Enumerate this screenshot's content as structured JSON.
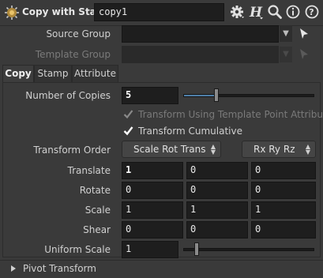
{
  "header": {
    "title": "Copy with Stamp",
    "node_name": "copy1",
    "icons": [
      "gear-icon",
      "help-h-icon",
      "search-icon",
      "info-icon",
      "question-icon"
    ]
  },
  "source_group": {
    "label": "Source Group",
    "value": ""
  },
  "template_group": {
    "label": "Template Group",
    "value": ""
  },
  "tabs": [
    {
      "label": "Copy",
      "active": true
    },
    {
      "label": "Stamp",
      "active": false
    },
    {
      "label": "Attribute",
      "active": false
    }
  ],
  "copy": {
    "num_copies": {
      "label": "Number of Copies",
      "value": "5",
      "slider_fraction": 0.25
    },
    "transform_using_template": {
      "label": "Transform Using Template Point Attributes",
      "checked": true,
      "enabled": false
    },
    "transform_cumulative": {
      "label": "Transform Cumulative",
      "checked": true,
      "enabled": true
    },
    "transform_order": {
      "label": "Transform Order",
      "value": "Scale Rot Trans",
      "rot_value": "Rx Ry Rz"
    },
    "translate": {
      "label": "Translate",
      "values": [
        "1",
        "0",
        "0"
      ]
    },
    "rotate": {
      "label": "Rotate",
      "values": [
        "0",
        "0",
        "0"
      ]
    },
    "scale": {
      "label": "Scale",
      "values": [
        "1",
        "1",
        "1"
      ]
    },
    "shear": {
      "label": "Shear",
      "values": [
        "0",
        "0",
        "0"
      ]
    },
    "uniform_scale": {
      "label": "Uniform Scale",
      "value": "1",
      "slider_fraction": 0.1
    }
  },
  "pivot": {
    "label": "Pivot Transform",
    "expanded": false
  },
  "colors": {
    "background": "#3a3a3a",
    "field": "#1e1e1e",
    "accent": "#4f7fa8"
  }
}
